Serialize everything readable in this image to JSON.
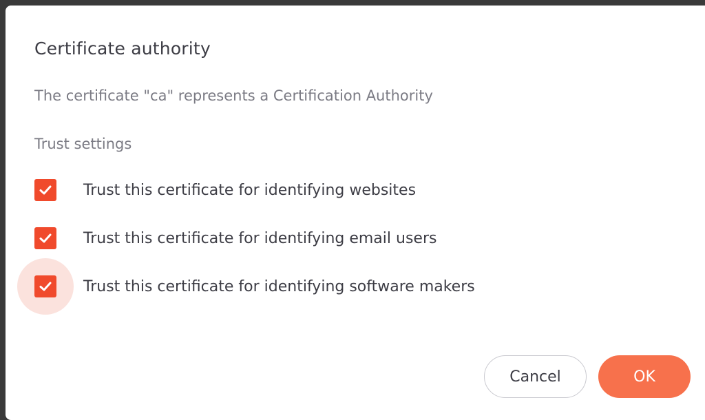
{
  "dialog": {
    "title": "Certificate authority",
    "description": "The certificate \"ca\" represents a Certification Authority",
    "section_label": "Trust settings",
    "options": [
      {
        "label": "Trust this certificate for identifying websites",
        "checked": true
      },
      {
        "label": "Trust this certificate for identifying email users",
        "checked": true
      },
      {
        "label": "Trust this certificate for identifying software makers",
        "checked": true
      }
    ],
    "buttons": {
      "cancel": "Cancel",
      "ok": "OK"
    }
  },
  "colors": {
    "accent": "#f04a2c",
    "ok_button": "#f7714c",
    "focus_ripple": "#fbe2dd"
  },
  "icons": {
    "checkbox_check": "check-icon"
  }
}
